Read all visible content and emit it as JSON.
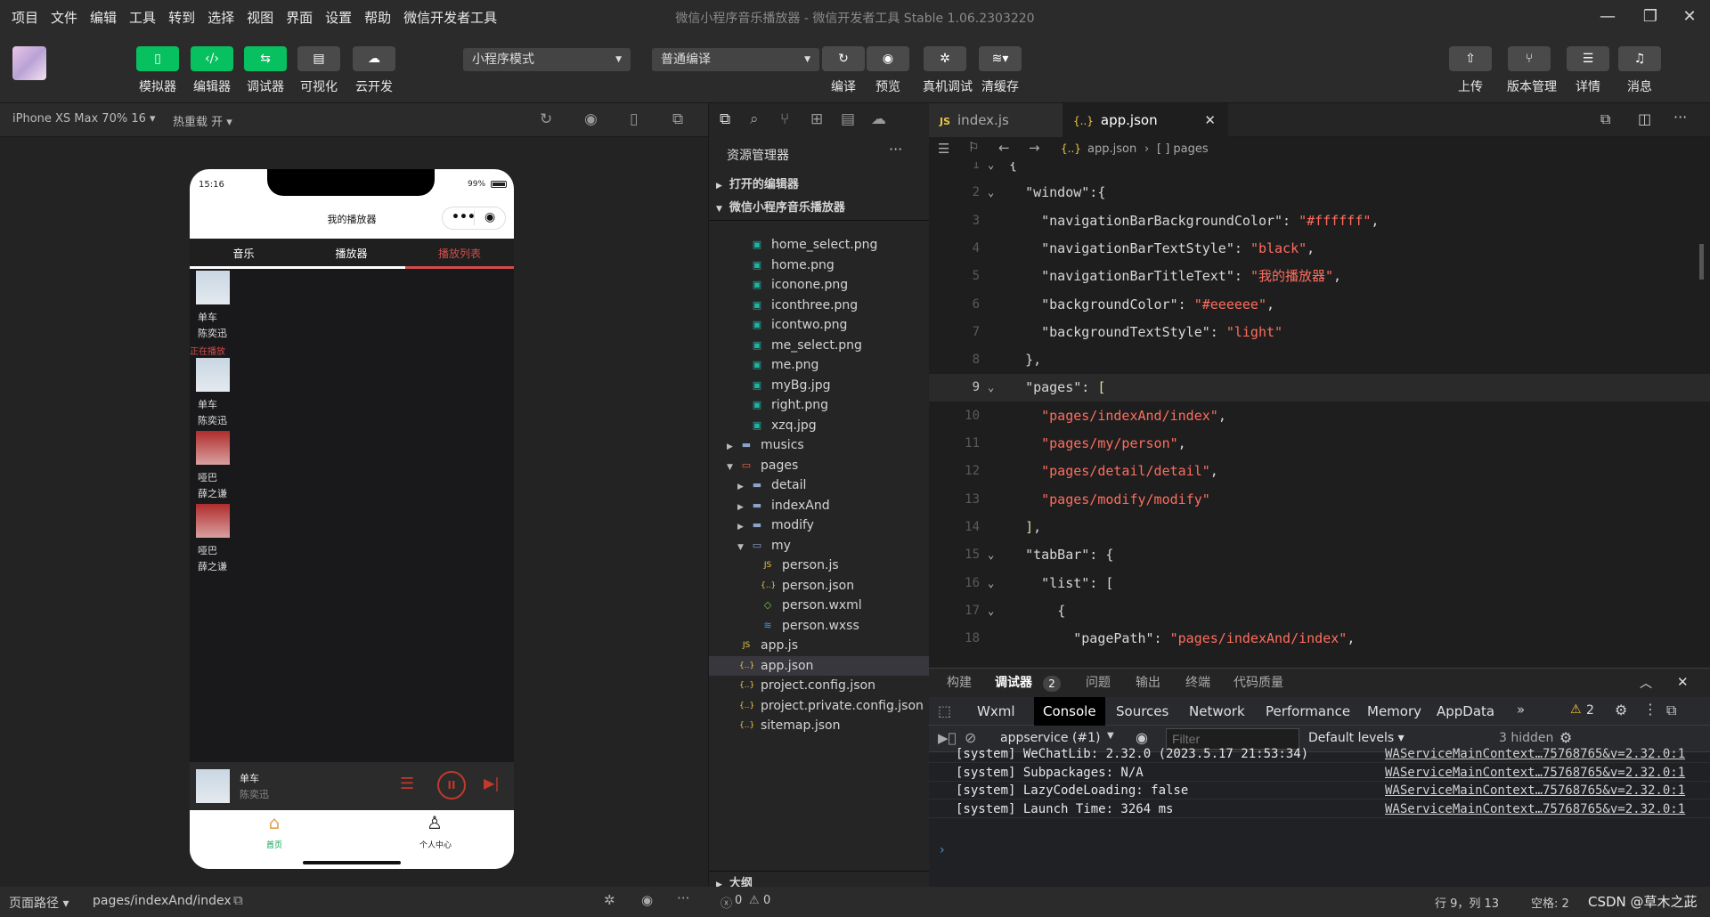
{
  "menu": [
    "项目",
    "文件",
    "编辑",
    "工具",
    "转到",
    "选择",
    "视图",
    "界面",
    "设置",
    "帮助",
    "微信开发者工具"
  ],
  "window_title": "微信小程序音乐播放器 - 微信开发者工具 Stable 1.06.2303220",
  "toolbar": {
    "simulator": "模拟器",
    "editor": "编辑器",
    "debugger": "调试器",
    "visual": "可视化",
    "cloud": "云开发",
    "mode_select": "小程序模式",
    "compile_select": "普通编译",
    "compile": "编译",
    "preview": "预览",
    "remote_debug": "真机调试",
    "clear_cache": "清缓存",
    "upload": "上传",
    "version": "版本管理",
    "details": "详情",
    "messages": "消息"
  },
  "sim_header": {
    "device": "iPhone XS Max 70% 16 ▾",
    "hot_reload": "热重载 开 ▾"
  },
  "phone": {
    "time": "15:16",
    "battery": "99%",
    "nav_title": "我的播放器",
    "tabs": [
      "音乐",
      "播放器",
      "播放列表"
    ],
    "playlist": [
      {
        "title": "单车",
        "artist": "陈奕迅",
        "badge": "正在播放"
      },
      {
        "title": "单车",
        "artist": "陈奕迅",
        "badge": ""
      },
      {
        "title": "哑巴",
        "artist": "薛之谦",
        "badge": ""
      },
      {
        "title": "哑巴",
        "artist": "薛之谦",
        "badge": ""
      }
    ],
    "player": {
      "title": "单车",
      "artist": "陈奕迅"
    },
    "tabbar": {
      "home": "首页",
      "me": "个人中心"
    },
    "accent": "#c0392b"
  },
  "sim_footer": {
    "path_label": "页面路径 ▾",
    "path": "pages/indexAnd/index"
  },
  "explorer": {
    "title": "资源管理器",
    "open_editors": "打开的编辑器",
    "project": "微信小程序音乐播放器",
    "outline": "大纲",
    "files": [
      {
        "name": "home_select.png",
        "type": "img",
        "indent": 2
      },
      {
        "name": "home.png",
        "type": "img",
        "indent": 2
      },
      {
        "name": "iconone.png",
        "type": "img",
        "indent": 2
      },
      {
        "name": "iconthree.png",
        "type": "img",
        "indent": 2
      },
      {
        "name": "icontwo.png",
        "type": "img",
        "indent": 2
      },
      {
        "name": "me_select.png",
        "type": "img",
        "indent": 2
      },
      {
        "name": "me.png",
        "type": "img",
        "indent": 2
      },
      {
        "name": "myBg.jpg",
        "type": "img",
        "indent": 2
      },
      {
        "name": "right.png",
        "type": "img",
        "indent": 2
      },
      {
        "name": "xzq.jpg",
        "type": "img",
        "indent": 2
      },
      {
        "name": "musics",
        "type": "folder",
        "indent": 1
      },
      {
        "name": "pages",
        "type": "folder-open-red",
        "indent": 1
      },
      {
        "name": "detail",
        "type": "folder",
        "indent": 2
      },
      {
        "name": "indexAnd",
        "type": "folder",
        "indent": 2
      },
      {
        "name": "modify",
        "type": "folder",
        "indent": 2
      },
      {
        "name": "my",
        "type": "folder-open",
        "indent": 2
      },
      {
        "name": "person.js",
        "type": "js",
        "indent": 3
      },
      {
        "name": "person.json",
        "type": "json",
        "indent": 3
      },
      {
        "name": "person.wxml",
        "type": "wxml",
        "indent": 3
      },
      {
        "name": "person.wxss",
        "type": "wxss",
        "indent": 3
      },
      {
        "name": "app.js",
        "type": "js",
        "indent": 1
      },
      {
        "name": "app.json",
        "type": "json",
        "indent": 1,
        "active": true
      },
      {
        "name": "project.config.json",
        "type": "json",
        "indent": 1
      },
      {
        "name": "project.private.config.json",
        "type": "json",
        "indent": 1
      },
      {
        "name": "sitemap.json",
        "type": "json",
        "indent": 1
      }
    ]
  },
  "editor": {
    "tabs": [
      {
        "name": "index.js",
        "icon": "JS"
      },
      {
        "name": "app.json",
        "icon": "{..}",
        "active": true
      }
    ],
    "breadcrumb": {
      "file": "app.json",
      "node": "[ ] pages"
    },
    "lines": [
      {
        "n": "1",
        "fold": true,
        "html": "<span class='k'>{</span>"
      },
      {
        "n": "2",
        "fold": true,
        "html": "  <span class='k'>\"window\":{</span>"
      },
      {
        "n": "3",
        "html": "    <span class='k'>\"navigationBarBackgroundColor\": </span><span class='s'>\"#ffffff\"</span><span class='k'>,</span>"
      },
      {
        "n": "4",
        "html": "    <span class='k'>\"navigationBarTextStyle\": </span><span class='s'>\"black\"</span><span class='k'>,</span>"
      },
      {
        "n": "5",
        "html": "    <span class='k'>\"navigationBarTitleText\": </span><span class='s'>\"我的播放器\"</span><span class='k'>,</span>"
      },
      {
        "n": "6",
        "html": "    <span class='k'>\"backgroundColor\": </span><span class='s'>\"#eeeeee\"</span><span class='k'>,</span>"
      },
      {
        "n": "7",
        "html": "    <span class='k'>\"backgroundTextStyle\": </span><span class='s'>\"light\"</span>"
      },
      {
        "n": "8",
        "html": "  <span class='k'>},</span>"
      },
      {
        "n": "9",
        "fold": true,
        "cur": true,
        "html": "  <span class='k'>\"pages\": </span><span class='p'>[</span>"
      },
      {
        "n": "10",
        "html": "    <span class='s'>\"pages/indexAnd/index\"</span><span class='k'>,</span>"
      },
      {
        "n": "11",
        "html": "    <span class='s'>\"pages/my/person\"</span><span class='k'>,</span>"
      },
      {
        "n": "12",
        "html": "    <span class='s'>\"pages/detail/detail\"</span><span class='k'>,</span>"
      },
      {
        "n": "13",
        "html": "    <span class='s'>\"pages/modify/modify\"</span>"
      },
      {
        "n": "14",
        "html": "  <span class='p'>]</span><span class='k'>,</span>"
      },
      {
        "n": "15",
        "fold": true,
        "html": "  <span class='k'>\"tabBar\": {</span>"
      },
      {
        "n": "16",
        "fold": true,
        "html": "    <span class='k'>\"list\": [</span>"
      },
      {
        "n": "17",
        "fold": true,
        "html": "      <span class='k'>{</span>"
      },
      {
        "n": "18",
        "html": "        <span class='k'>\"pagePath\": </span><span class='s'>\"pages/indexAnd/index\"</span><span class='k'>,</span>"
      }
    ]
  },
  "debugger": {
    "panel_tabs": [
      "构建",
      "调试器",
      "问题",
      "输出",
      "终端",
      "代码质量"
    ],
    "badge": "2",
    "devtabs": [
      "Wxml",
      "Console",
      "Sources",
      "Network",
      "Performance",
      "Memory",
      "AppData"
    ],
    "warn_count": "2",
    "context": "appservice (#1)",
    "filter_placeholder": "Filter",
    "levels": "Default levels ▾",
    "hidden": "3 hidden",
    "logs": [
      {
        "msg": "[system] WeChatLib: 2.32.0 (2023.5.17 21:53:34)",
        "src": "WAServiceMainContext…75768765&v=2.32.0:1"
      },
      {
        "msg": "[system] Subpackages: N/A",
        "src": "WAServiceMainContext…75768765&v=2.32.0:1"
      },
      {
        "msg": "[system] LazyCodeLoading: false",
        "src": "WAServiceMainContext…75768765&v=2.32.0:1"
      },
      {
        "msg": "[system] Launch Time: 3264 ms",
        "src": "WAServiceMainContext…75768765&v=2.32.0:1"
      }
    ]
  },
  "status": {
    "errors": "0",
    "warnings": "0",
    "position": "行 9，列 13",
    "spaces": "空格: 2",
    "watermark": "CSDN @草木之茈"
  }
}
